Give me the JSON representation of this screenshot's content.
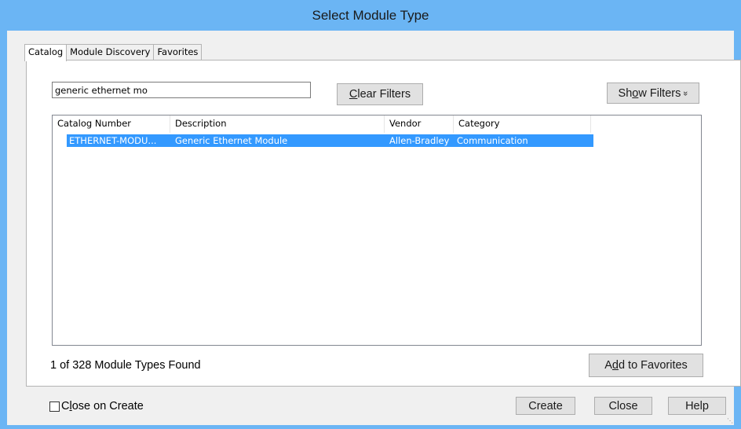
{
  "window": {
    "title": "Select Module Type"
  },
  "tabs": [
    {
      "label": "Catalog",
      "active": true
    },
    {
      "label": "Module Discovery",
      "active": false
    },
    {
      "label": "Favorites",
      "active": false
    }
  ],
  "search": {
    "value": "generic ethernet mo"
  },
  "buttons": {
    "clear_filters": {
      "pre": "",
      "key": "C",
      "post": "lear Filters"
    },
    "show_filters": {
      "pre": "Sh",
      "key": "o",
      "post": "w Filters",
      "icon": "double-chevron-down-icon",
      "glyph": "»"
    },
    "add_favorites": {
      "pre": "A",
      "key": "d",
      "post": "d to Favorites"
    },
    "create": "Create",
    "close": "Close",
    "help": "Help"
  },
  "table": {
    "columns": [
      "Catalog Number",
      "Description",
      "Vendor",
      "Category"
    ],
    "rows": [
      {
        "catalog_number": "ETHERNET-MODU...",
        "description": "Generic Ethernet Module",
        "vendor": "Allen-Bradley",
        "category": "Communication",
        "selected": true
      }
    ]
  },
  "status": {
    "text": "1 of 328 Module Types Found"
  },
  "close_on_create": {
    "pre": "C",
    "key": "l",
    "post": "ose on Create",
    "checked": false
  },
  "colors": {
    "titlebar": "#6bb5f4",
    "selection": "#3399ff",
    "dialog_bg": "#f0f0f0"
  }
}
